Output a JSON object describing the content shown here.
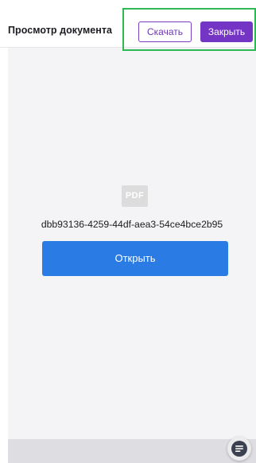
{
  "header": {
    "title": "Просмотр документа",
    "download_label": "Скачать",
    "close_label": "Закрыть"
  },
  "viewer": {
    "file_type_badge": "PDF",
    "file_name": "dbb93136-4259-44df-aea3-54ce4bce2b95",
    "open_label": "Открыть"
  },
  "fab": {
    "icon": "chat-icon"
  },
  "colors": {
    "accent_purple": "#7434c4",
    "open_button_blue": "#2a7be4",
    "highlight_green": "#2eb855",
    "viewer_background": "#f4f4f6"
  }
}
